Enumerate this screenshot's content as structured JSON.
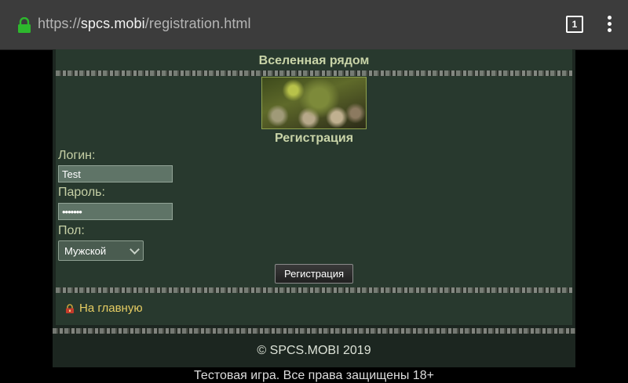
{
  "browser": {
    "url_prefix": "https://",
    "url_domain": "spcs.mobi",
    "url_path": "/registration.html",
    "tab_count": "1",
    "lock_icon": "lock-icon",
    "menu_icon": "more-vert-icon"
  },
  "site": {
    "title": "Вселенная рядом",
    "banner_icon": "game-banner-image"
  },
  "form": {
    "heading": "Регистрация",
    "login_label": "Логин:",
    "login_value": "Test",
    "password_label": "Пароль:",
    "password_value": "•••••••",
    "gender_label": "Пол:",
    "gender_selected": "Мужской",
    "submit_label": "Регистрация"
  },
  "nav": {
    "home_label": "На главную",
    "home_icon": "lock-home-icon"
  },
  "footer": {
    "copyright": "© SPCS.MOBI 2019",
    "note": "Тестовая игра. Все права защищены 18+"
  },
  "colors": {
    "chrome_bg": "#3c3c3c",
    "panel_bg": "#28392e",
    "accent_text": "#c9d4a8",
    "link": "#e6cd63",
    "lock_green": "#2db82d"
  }
}
